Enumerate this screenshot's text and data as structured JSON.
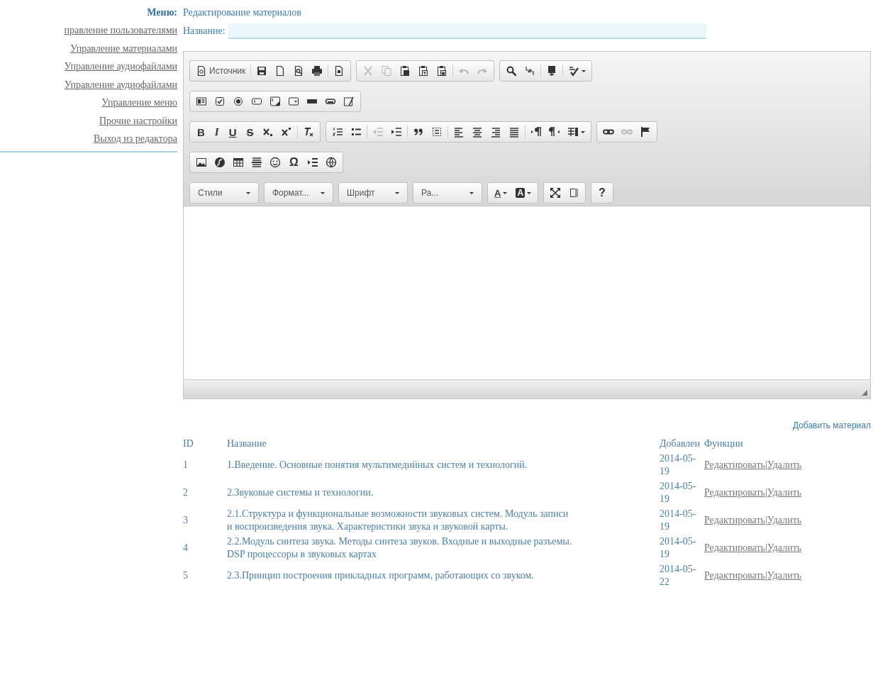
{
  "menu": {
    "label": "Меню:",
    "title": "Редактирование материалов"
  },
  "sidebar": {
    "items": [
      {
        "label": "правление пользователями"
      },
      {
        "label": "Управление материалами"
      },
      {
        "label": "Управление аудиофайлами"
      },
      {
        "label": "Управление аудиофайлами"
      },
      {
        "label": "Управление меню"
      },
      {
        "label": "Прочие настройки"
      },
      {
        "label": "Выход из редактора"
      }
    ]
  },
  "name_field": {
    "label": "Название:"
  },
  "editor": {
    "toolbar": [
      [
        {
          "items": [
            {
              "kind": "labeled",
              "label": "Источник",
              "disabled": false
            },
            {
              "kind": "separator"
            },
            {
              "kind": "icon",
              "disabled": false
            },
            {
              "kind": "icon",
              "disabled": false
            },
            {
              "kind": "icon",
              "disabled": false
            },
            {
              "kind": "icon",
              "disabled": false
            },
            {
              "kind": "separator"
            },
            {
              "kind": "icon",
              "disabled": false
            }
          ]
        },
        {
          "items": [
            {
              "kind": "icon",
              "disabled": true
            },
            {
              "kind": "icon",
              "disabled": true
            },
            {
              "kind": "icon",
              "disabled": false
            },
            {
              "kind": "icon",
              "disabled": false
            },
            {
              "kind": "icon",
              "disabled": false
            },
            {
              "kind": "separator"
            },
            {
              "kind": "icon",
              "disabled": true
            },
            {
              "kind": "icon",
              "disabled": true
            }
          ]
        },
        {
          "items": [
            {
              "kind": "icon",
              "disabled": false
            },
            {
              "kind": "icon",
              "disabled": false
            },
            {
              "kind": "separator"
            },
            {
              "kind": "icon",
              "disabled": false
            },
            {
              "kind": "separator"
            },
            {
              "kind": "icon-caret",
              "disabled": false
            }
          ]
        }
      ],
      [
        {
          "items": [
            {
              "kind": "icon",
              "disabled": false
            },
            {
              "kind": "icon",
              "disabled": false
            },
            {
              "kind": "icon",
              "disabled": false
            },
            {
              "kind": "icon",
              "disabled": false
            },
            {
              "kind": "icon",
              "disabled": false
            },
            {
              "kind": "icon",
              "disabled": false
            },
            {
              "kind": "icon",
              "disabled": false
            },
            {
              "kind": "icon",
              "disabled": false
            },
            {
              "kind": "icon",
              "disabled": false
            }
          ]
        }
      ],
      [
        {
          "items": [
            {
              "kind": "bold",
              "label": "B",
              "disabled": false
            },
            {
              "kind": "italic",
              "label": "I",
              "disabled": false
            },
            {
              "kind": "underline",
              "label": "U",
              "disabled": false
            },
            {
              "kind": "strike",
              "label": "S",
              "disabled": false
            },
            {
              "kind": "icon",
              "disabled": false
            },
            {
              "kind": "icon",
              "disabled": false
            },
            {
              "kind": "separator"
            },
            {
              "kind": "icon",
              "disabled": false
            }
          ]
        },
        {
          "items": [
            {
              "kind": "icon",
              "disabled": false
            },
            {
              "kind": "icon",
              "disabled": false
            },
            {
              "kind": "separator"
            },
            {
              "kind": "icon",
              "disabled": true
            },
            {
              "kind": "icon",
              "disabled": false
            },
            {
              "kind": "separator"
            },
            {
              "kind": "icon",
              "disabled": false
            },
            {
              "kind": "icon",
              "disabled": false
            },
            {
              "kind": "separator"
            },
            {
              "kind": "icon",
              "disabled": false
            },
            {
              "kind": "icon",
              "disabled": false
            },
            {
              "kind": "icon",
              "disabled": false
            },
            {
              "kind": "icon",
              "disabled": false
            },
            {
              "kind": "separator"
            },
            {
              "kind": "icon",
              "disabled": false
            },
            {
              "kind": "icon",
              "disabled": false
            },
            {
              "kind": "icon-caret",
              "disabled": false
            }
          ]
        },
        {
          "items": [
            {
              "kind": "icon",
              "disabled": false
            },
            {
              "kind": "icon",
              "disabled": true
            },
            {
              "kind": "icon",
              "disabled": false
            }
          ]
        }
      ],
      [
        {
          "items": [
            {
              "kind": "icon",
              "disabled": false
            },
            {
              "kind": "icon",
              "disabled": false
            },
            {
              "kind": "icon",
              "disabled": false
            },
            {
              "kind": "icon",
              "disabled": false
            },
            {
              "kind": "icon",
              "disabled": false
            },
            {
              "kind": "glyph",
              "label": "Ω",
              "disabled": false
            },
            {
              "kind": "icon",
              "disabled": false
            },
            {
              "kind": "icon",
              "disabled": false
            }
          ]
        }
      ],
      [
        {
          "items": [
            {
              "kind": "combo",
              "label": "Стили",
              "disabled": false
            }
          ]
        },
        {
          "items": [
            {
              "kind": "combo",
              "label": "Формат...",
              "disabled": false
            }
          ]
        },
        {
          "items": [
            {
              "kind": "combo",
              "label": "Шрифт",
              "disabled": false
            }
          ]
        },
        {
          "items": [
            {
              "kind": "combo",
              "label": "Ра...",
              "disabled": false
            }
          ]
        },
        {
          "items": [
            {
              "kind": "color",
              "label": "A",
              "disabled": false
            },
            {
              "kind": "bgcolor",
              "label": "A",
              "disabled": false
            }
          ]
        },
        {
          "items": [
            {
              "kind": "icon",
              "disabled": false
            },
            {
              "kind": "icon",
              "disabled": false
            }
          ]
        },
        {
          "items": [
            {
              "kind": "glyph",
              "label": "?",
              "disabled": false
            }
          ]
        }
      ]
    ]
  },
  "add_link": "Добавить материал",
  "table": {
    "columns": [
      "ID",
      "Название",
      "Добавлен",
      "Функции"
    ],
    "rows": [
      {
        "id": "1",
        "title": "1.Введение. Основные понятия мультимедийных систем и технологий.",
        "added": "2014-05-19",
        "actions": [
          "Редактировать",
          "Удалить"
        ],
        "separator": "|"
      },
      {
        "id": "2",
        "title": "2.Звуковые системы и технологии.",
        "added": "2014-05-19",
        "actions": [
          "Редактировать",
          "Удалить"
        ],
        "separator": "|"
      },
      {
        "id": "3",
        "title": "2.1.Структура и функциональные возможности звуковых систем. Модуль записи и воспроизведения звука. Характеристики звука и звуковой карты.",
        "added": "2014-05-19",
        "actions": [
          "Редактировать",
          "Удалить"
        ],
        "separator": "|"
      },
      {
        "id": "4",
        "title": "2.2.Модуль синтеза звука. Методы синтеза звуков. Входные и выходные разъемы. DSP процессоры в звуковых картах",
        "added": "2014-05-19",
        "actions": [
          "Редактировать",
          "Удалить"
        ],
        "separator": "|"
      },
      {
        "id": "5",
        "title": "2.3.Принцип построения прикладных программ, работающих со звуком.",
        "added": "2014-05-22",
        "actions": [
          "Редактировать",
          "Удалить"
        ],
        "separator": "|"
      }
    ]
  }
}
